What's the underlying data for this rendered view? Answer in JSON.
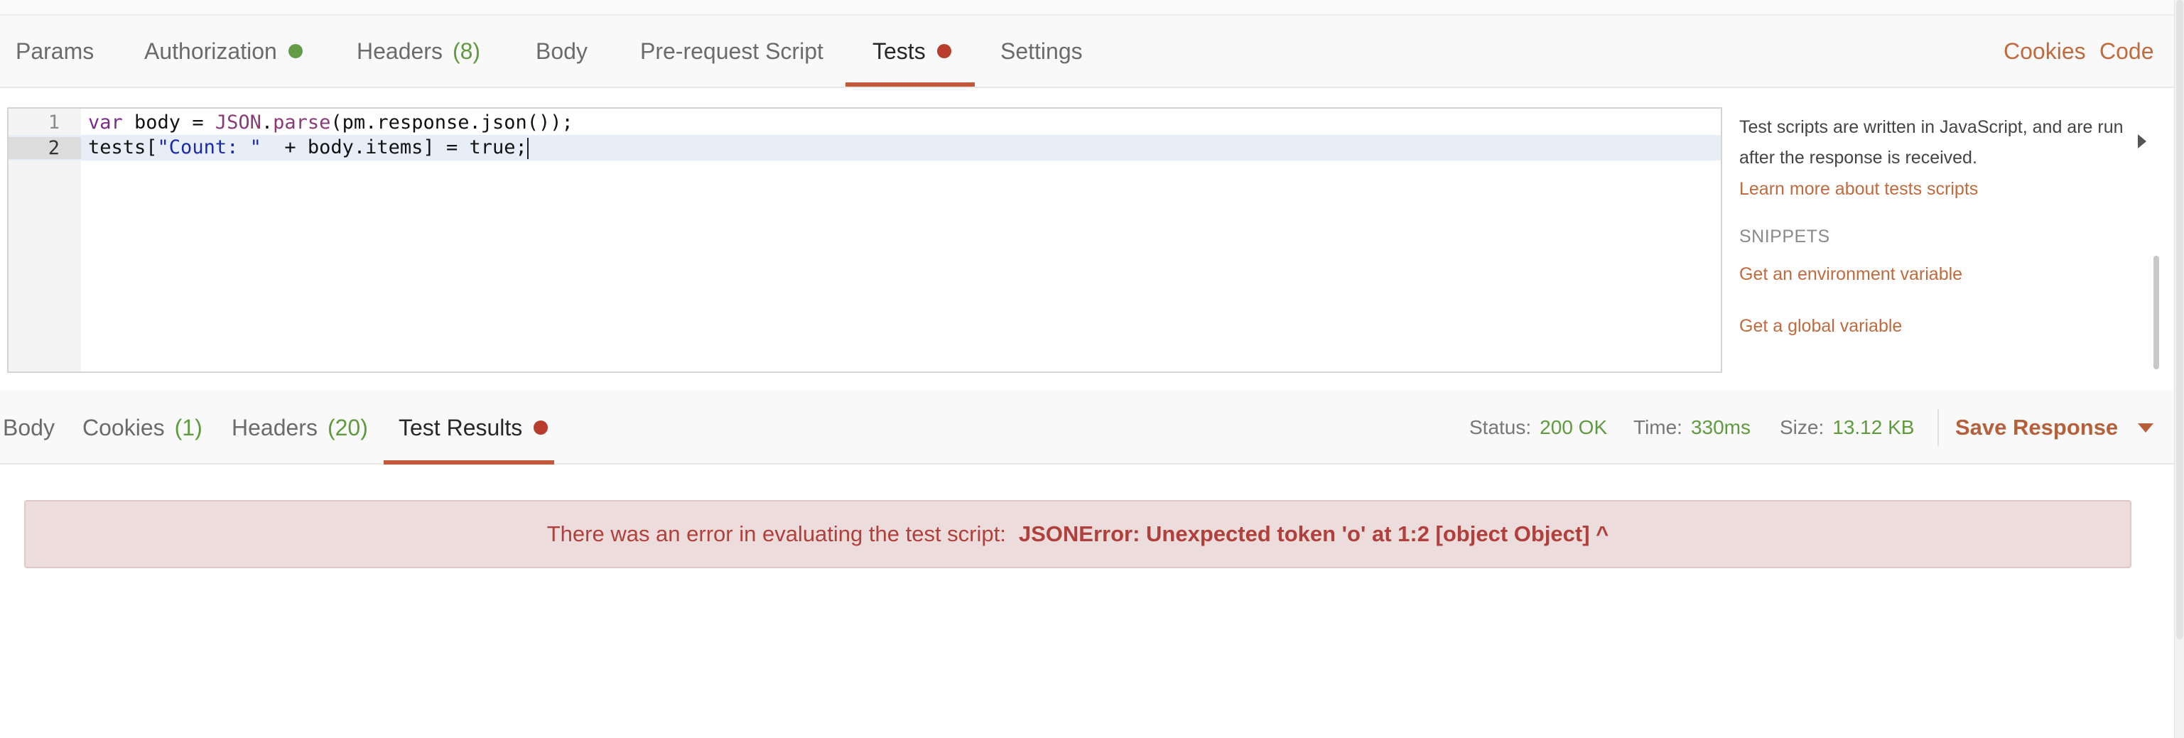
{
  "request_tabs": [
    {
      "label": "Params"
    },
    {
      "label": "Authorization",
      "indicator": "green-dot"
    },
    {
      "label": "Headers",
      "count": "(8)"
    },
    {
      "label": "Body"
    },
    {
      "label": "Pre-request Script"
    },
    {
      "label": "Tests",
      "indicator": "red-dot",
      "active": true
    },
    {
      "label": "Settings"
    }
  ],
  "top_links": {
    "cookies": "Cookies",
    "code": "Code"
  },
  "editor": {
    "lines": [
      {
        "number": "1",
        "tokens": {
          "kw": "var",
          "t1": " body = ",
          "t2": "JSON",
          "t3": ".",
          "fn": "parse",
          "t4": "(pm.response.json());"
        }
      },
      {
        "number": "2",
        "tokens": {
          "t1": "tests[",
          "str": "\"Count: \"",
          "t2": "  + body.items] = true;"
        }
      }
    ],
    "current_line": 2
  },
  "sidebar": {
    "description": "Test scripts are written in JavaScript, and are run after the response is received.",
    "learn_more": "Learn more about tests scripts",
    "snippets_title": "SNIPPETS",
    "snippets": [
      "Get an environment variable",
      "Get a global variable"
    ]
  },
  "response_tabs": [
    {
      "label": "Body"
    },
    {
      "label": "Cookies",
      "count": "(1)"
    },
    {
      "label": "Headers",
      "count": "(20)"
    },
    {
      "label": "Test Results",
      "indicator": "red-dot",
      "active": true
    }
  ],
  "response_stats": {
    "status_label": "Status:",
    "status_value": "200 OK",
    "time_label": "Time:",
    "time_value": "330ms",
    "size_label": "Size:",
    "size_value": "13.12 KB"
  },
  "save_response": {
    "label": "Save Response",
    "icon": "chevron-down-icon"
  },
  "error": {
    "message": "There was an error in evaluating the test script:",
    "detail": "JSONError: Unexpected token 'o' at 1:2 [object Object] ^"
  },
  "colors": {
    "accent": "#c2593a",
    "link": "#c06a3e",
    "count_green": "#5f9b3e",
    "dot_green": "#659c48",
    "dot_red": "#b83d2d",
    "error_bg": "#eddcdc",
    "error_text": "#b0403b"
  }
}
